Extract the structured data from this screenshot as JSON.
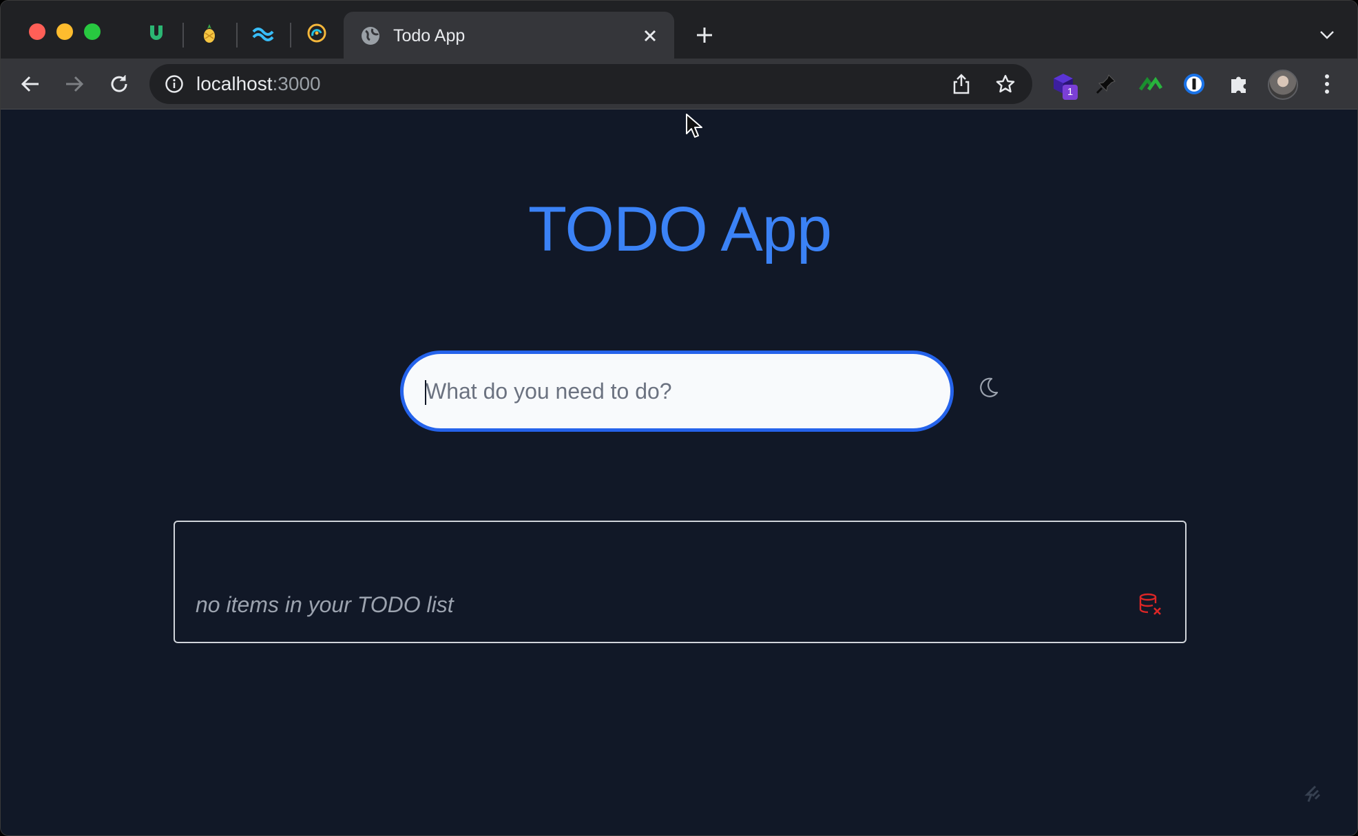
{
  "browser": {
    "tabs": {
      "active_title": "Todo App"
    },
    "address_bar": {
      "host": "localhost",
      "port": ":3000"
    },
    "extensions": {
      "badge_count": "1"
    }
  },
  "app": {
    "title": "TODO App",
    "input": {
      "placeholder": "What do you need to do?",
      "value": ""
    },
    "list": {
      "empty_message": "no items in your TODO list"
    },
    "colors": {
      "page_background": "#111827",
      "title_blue": "#3b82f6",
      "input_border": "#2563eb",
      "clear_red": "#dc2626"
    },
    "icons": {
      "theme_toggle": "moon-icon",
      "clear_list": "database-x-icon"
    }
  }
}
